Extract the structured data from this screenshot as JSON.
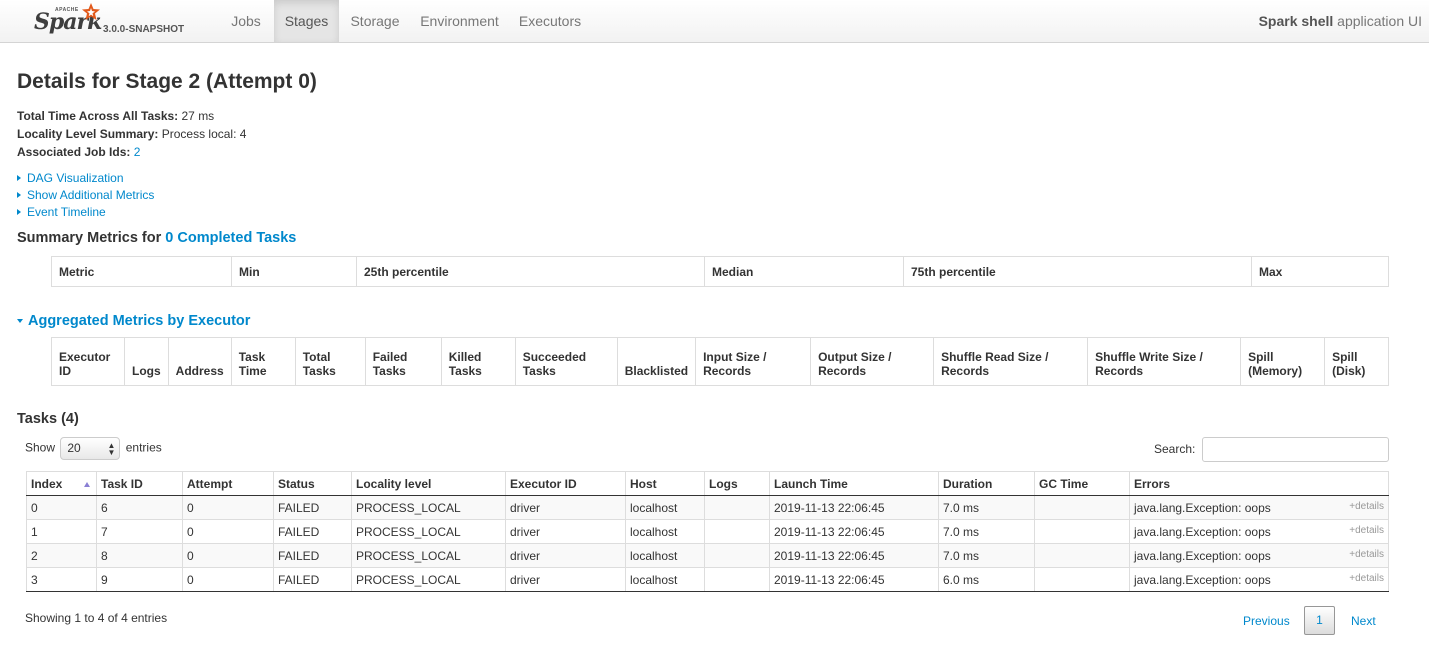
{
  "navbar": {
    "brand_apache": "APACHE",
    "brand_name": "Spark",
    "version": "3.0.0-SNAPSHOT",
    "tabs": [
      "Jobs",
      "Stages",
      "Storage",
      "Environment",
      "Executors"
    ],
    "active_tab": "Stages",
    "app_name": "Spark shell",
    "app_suffix": " application UI"
  },
  "page": {
    "title": "Details for Stage 2 (Attempt 0)",
    "total_time_label": "Total Time Across All Tasks:",
    "total_time_value": " 27 ms",
    "locality_label": "Locality Level Summary:",
    "locality_value": " Process local: 4",
    "job_ids_label": "Associated Job Ids:",
    "job_ids_value": "2",
    "toggles": [
      "DAG Visualization",
      "Show Additional Metrics",
      "Event Timeline"
    ]
  },
  "summary_metrics": {
    "heading_prefix": "Summary Metrics for ",
    "heading_link": "0 Completed Tasks",
    "columns": [
      "Metric",
      "Min",
      "25th percentile",
      "Median",
      "75th percentile",
      "Max"
    ]
  },
  "aggregated": {
    "heading": "Aggregated Metrics by Executor",
    "columns": [
      [
        "Executor",
        "ID"
      ],
      [
        "",
        "Logs"
      ],
      [
        "",
        "Address"
      ],
      [
        "Task",
        "Time"
      ],
      [
        "Total",
        "Tasks"
      ],
      [
        "Failed",
        "Tasks"
      ],
      [
        "Killed",
        "Tasks"
      ],
      [
        "Succeeded",
        "Tasks"
      ],
      [
        "",
        "Blacklisted"
      ],
      [
        "Input Size /",
        "Records"
      ],
      [
        "Output Size /",
        "Records"
      ],
      [
        "Shuffle Read Size /",
        "Records"
      ],
      [
        "Shuffle Write Size /",
        "Records"
      ],
      [
        "Spill",
        "(Memory)"
      ],
      [
        "Spill",
        "(Disk)"
      ]
    ]
  },
  "tasks": {
    "heading": "Tasks (4)",
    "show_label": "Show",
    "page_size": "20",
    "entries_label": "entries",
    "search_label": "Search:",
    "search_value": "",
    "columns": [
      "Index",
      "Task ID",
      "Attempt",
      "Status",
      "Locality level",
      "Executor ID",
      "Host",
      "Logs",
      "Launch Time",
      "Duration",
      "GC Time",
      "Errors"
    ],
    "rows": [
      [
        "0",
        "6",
        "0",
        "FAILED",
        "PROCESS_LOCAL",
        "driver",
        "localhost",
        "",
        "2019-11-13 22:06:45",
        "7.0 ms",
        "",
        "java.lang.Exception: oops"
      ],
      [
        "1",
        "7",
        "0",
        "FAILED",
        "PROCESS_LOCAL",
        "driver",
        "localhost",
        "",
        "2019-11-13 22:06:45",
        "7.0 ms",
        "",
        "java.lang.Exception: oops"
      ],
      [
        "2",
        "8",
        "0",
        "FAILED",
        "PROCESS_LOCAL",
        "driver",
        "localhost",
        "",
        "2019-11-13 22:06:45",
        "7.0 ms",
        "",
        "java.lang.Exception: oops"
      ],
      [
        "3",
        "9",
        "0",
        "FAILED",
        "PROCESS_LOCAL",
        "driver",
        "localhost",
        "",
        "2019-11-13 22:06:45",
        "6.0 ms",
        "",
        "java.lang.Exception: oops"
      ]
    ],
    "details_label": "+details",
    "info": "Showing 1 to 4 of 4 entries",
    "previous": "Previous",
    "current_page": "1",
    "next": "Next"
  },
  "colors": {
    "link": "#0088cc",
    "active_tab_bg": "#e5e5e5",
    "sort_arrow": "#8a7fd4"
  }
}
